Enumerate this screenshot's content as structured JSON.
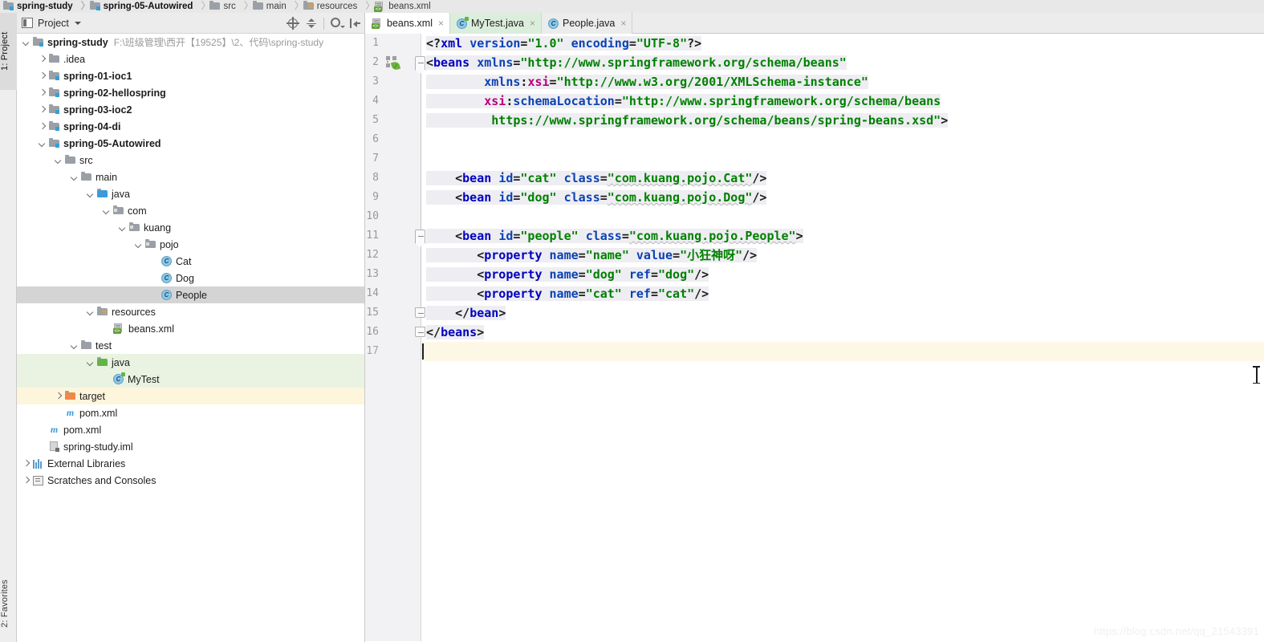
{
  "breadcrumb": {
    "items": [
      {
        "label": "spring-study",
        "icon": "module-icon",
        "bold": true
      },
      {
        "label": "spring-05-Autowired",
        "icon": "module-icon",
        "bold": true
      },
      {
        "label": "src",
        "icon": "folder-icon",
        "bold": false
      },
      {
        "label": "main",
        "icon": "folder-icon",
        "bold": false
      },
      {
        "label": "resources",
        "icon": "resources-folder-icon",
        "bold": false
      },
      {
        "label": "beans.xml",
        "icon": "xml-file-icon",
        "bold": false
      }
    ]
  },
  "left_strip": {
    "project_tab": "1: Project",
    "favorites_tab": "2: Favorites"
  },
  "project_panel": {
    "title": "Project",
    "toolbar": {
      "locate": "locate-in-tree-icon",
      "collapse_all": "collapse-all-icon",
      "settings": "gear-icon",
      "hide": "hide-panel-icon"
    },
    "tree": [
      {
        "id": "spring-study",
        "depth": 0,
        "arrow": "down",
        "icon": "module-icon",
        "label": "spring-study",
        "bold": true,
        "path": "F:\\班级管理\\西开【19525】\\2、代码\\spring-study",
        "state": "none"
      },
      {
        "id": "idea",
        "depth": 1,
        "arrow": "right",
        "icon": "folder-icon",
        "label": ".idea",
        "bold": false,
        "path": "",
        "state": "none"
      },
      {
        "id": "spring-01-ioc1",
        "depth": 1,
        "arrow": "right",
        "icon": "module-icon",
        "label": "spring-01-ioc1",
        "bold": true,
        "path": "",
        "state": "none"
      },
      {
        "id": "spring-02-hellospring",
        "depth": 1,
        "arrow": "right",
        "icon": "module-icon",
        "label": "spring-02-hellospring",
        "bold": true,
        "path": "",
        "state": "none"
      },
      {
        "id": "spring-03-ioc2",
        "depth": 1,
        "arrow": "right",
        "icon": "module-icon",
        "label": "spring-03-ioc2",
        "bold": true,
        "path": "",
        "state": "none"
      },
      {
        "id": "spring-04-di",
        "depth": 1,
        "arrow": "right",
        "icon": "module-icon",
        "label": "spring-04-di",
        "bold": true,
        "path": "",
        "state": "none"
      },
      {
        "id": "spring-05-Autowired",
        "depth": 1,
        "arrow": "down",
        "icon": "module-icon",
        "label": "spring-05-Autowired",
        "bold": true,
        "path": "",
        "state": "none"
      },
      {
        "id": "src",
        "depth": 2,
        "arrow": "down",
        "icon": "folder-icon",
        "label": "src",
        "bold": false,
        "path": "",
        "state": "none"
      },
      {
        "id": "main",
        "depth": 3,
        "arrow": "down",
        "icon": "folder-icon",
        "label": "main",
        "bold": false,
        "path": "",
        "state": "none"
      },
      {
        "id": "java",
        "depth": 4,
        "arrow": "down",
        "icon": "source-folder-icon",
        "label": "java",
        "bold": false,
        "path": "",
        "state": "none"
      },
      {
        "id": "com",
        "depth": 5,
        "arrow": "down",
        "icon": "package-icon",
        "label": "com",
        "bold": false,
        "path": "",
        "state": "none"
      },
      {
        "id": "kuang",
        "depth": 6,
        "arrow": "down",
        "icon": "package-icon",
        "label": "kuang",
        "bold": false,
        "path": "",
        "state": "none"
      },
      {
        "id": "pojo",
        "depth": 7,
        "arrow": "down",
        "icon": "package-icon",
        "label": "pojo",
        "bold": false,
        "path": "",
        "state": "none"
      },
      {
        "id": "Cat",
        "depth": 8,
        "arrow": "none",
        "icon": "java-class-icon",
        "label": "Cat",
        "bold": false,
        "path": "",
        "state": "none"
      },
      {
        "id": "Dog",
        "depth": 8,
        "arrow": "none",
        "icon": "java-class-icon",
        "label": "Dog",
        "bold": false,
        "path": "",
        "state": "none"
      },
      {
        "id": "People",
        "depth": 8,
        "arrow": "none",
        "icon": "java-class-icon",
        "label": "People",
        "bold": false,
        "path": "",
        "state": "selected"
      },
      {
        "id": "resources",
        "depth": 4,
        "arrow": "down",
        "icon": "resources-folder-icon",
        "label": "resources",
        "bold": false,
        "path": "",
        "state": "none"
      },
      {
        "id": "beans.xml",
        "depth": 5,
        "arrow": "none",
        "icon": "xml-file-icon",
        "label": "beans.xml",
        "bold": false,
        "path": "",
        "state": "none"
      },
      {
        "id": "test",
        "depth": 3,
        "arrow": "down",
        "icon": "folder-icon",
        "label": "test",
        "bold": false,
        "path": "",
        "state": "none"
      },
      {
        "id": "test-java",
        "depth": 4,
        "arrow": "down",
        "icon": "test-source-folder-icon",
        "label": "java",
        "bold": false,
        "path": "",
        "state": "green"
      },
      {
        "id": "MyTest",
        "depth": 5,
        "arrow": "none",
        "icon": "java-test-class-icon",
        "label": "MyTest",
        "bold": false,
        "path": "",
        "state": "green"
      },
      {
        "id": "target",
        "depth": 2,
        "arrow": "right",
        "icon": "excluded-folder-icon",
        "label": "target",
        "bold": false,
        "path": "",
        "state": "yellow"
      },
      {
        "id": "module-pom",
        "depth": 2,
        "arrow": "none",
        "icon": "maven-icon",
        "label": "pom.xml",
        "bold": false,
        "path": "",
        "state": "none"
      },
      {
        "id": "root-pom",
        "depth": 1,
        "arrow": "none",
        "icon": "maven-icon",
        "label": "pom.xml",
        "bold": false,
        "path": "",
        "state": "none"
      },
      {
        "id": "spring-study.iml",
        "depth": 1,
        "arrow": "none",
        "icon": "iml-file-icon",
        "label": "spring-study.iml",
        "bold": false,
        "path": "",
        "state": "none"
      },
      {
        "id": "External Libraries",
        "depth": 0,
        "arrow": "right",
        "icon": "libraries-icon",
        "label": "External Libraries",
        "bold": false,
        "path": "",
        "state": "none"
      },
      {
        "id": "Scratches and Consoles",
        "depth": 0,
        "arrow": "right",
        "icon": "scratches-icon",
        "label": "Scratches and Consoles",
        "bold": false,
        "path": "",
        "state": "none"
      }
    ]
  },
  "editor": {
    "tabs": [
      {
        "label": "beans.xml",
        "icon": "xml-file-icon",
        "state": "active",
        "close": "×"
      },
      {
        "label": "MyTest.java",
        "icon": "java-test-class-icon",
        "state": "modified",
        "close": "×"
      },
      {
        "label": "People.java",
        "icon": "java-class-icon",
        "state": "inactive",
        "close": "×"
      }
    ],
    "line_numbers": [
      "1",
      "2",
      "3",
      "4",
      "5",
      "6",
      "7",
      "8",
      "9",
      "10",
      "11",
      "12",
      "13",
      "14",
      "15",
      "16",
      "17"
    ],
    "current_line": 17,
    "gutter_icons": [
      {
        "line": 2,
        "icon": "spring-bean-icon"
      }
    ],
    "code_lines": [
      {
        "n": 1,
        "indent": 0,
        "tokens": [
          {
            "t": "<?",
            "c": "punct"
          },
          {
            "t": "xml",
            "c": "tag"
          },
          {
            "t": " ",
            "c": "plain"
          },
          {
            "t": "version",
            "c": "attr"
          },
          {
            "t": "=",
            "c": "eq"
          },
          {
            "t": "\"1.0\"",
            "c": "val"
          },
          {
            "t": " ",
            "c": "plain"
          },
          {
            "t": "encoding",
            "c": "attr"
          },
          {
            "t": "=",
            "c": "eq"
          },
          {
            "t": "\"UTF-8\"",
            "c": "val"
          },
          {
            "t": "?>",
            "c": "punct"
          }
        ]
      },
      {
        "n": 2,
        "indent": 0,
        "tokens": [
          {
            "t": "<",
            "c": "punct"
          },
          {
            "t": "beans",
            "c": "tag"
          },
          {
            "t": " ",
            "c": "plain"
          },
          {
            "t": "xmlns",
            "c": "attr"
          },
          {
            "t": "=",
            "c": "eq"
          },
          {
            "t": "\"http://www.springframework.org/schema/beans\"",
            "c": "val"
          }
        ]
      },
      {
        "n": 3,
        "indent": 8,
        "tokens": [
          {
            "t": "xmlns",
            "c": "attr"
          },
          {
            "t": ":",
            "c": "punct"
          },
          {
            "t": "xsi",
            "c": "ns"
          },
          {
            "t": "=",
            "c": "eq"
          },
          {
            "t": "\"http://www.w3.org/2001/XMLSchema-instance\"",
            "c": "val"
          }
        ]
      },
      {
        "n": 4,
        "indent": 8,
        "tokens": [
          {
            "t": "xsi",
            "c": "ns"
          },
          {
            "t": ":",
            "c": "punct"
          },
          {
            "t": "schemaLocation",
            "c": "attr"
          },
          {
            "t": "=",
            "c": "eq"
          },
          {
            "t": "\"http://www.springframework.org/schema/beans",
            "c": "val"
          }
        ]
      },
      {
        "n": 5,
        "indent": 9,
        "tokens": [
          {
            "t": "https://www.springframework.org/schema/beans/spring-beans.xsd\"",
            "c": "val"
          },
          {
            "t": ">",
            "c": "punct"
          }
        ]
      },
      {
        "n": 6,
        "indent": 0,
        "tokens": []
      },
      {
        "n": 7,
        "indent": 0,
        "tokens": []
      },
      {
        "n": 8,
        "indent": 4,
        "tokens": [
          {
            "t": "<",
            "c": "punct"
          },
          {
            "t": "bean",
            "c": "tag"
          },
          {
            "t": " ",
            "c": "plain"
          },
          {
            "t": "id",
            "c": "attr"
          },
          {
            "t": "=",
            "c": "eq"
          },
          {
            "t": "\"cat\"",
            "c": "val"
          },
          {
            "t": " ",
            "c": "plain"
          },
          {
            "t": "class",
            "c": "attr"
          },
          {
            "t": "=",
            "c": "eq"
          },
          {
            "t": "\"com.kuang.pojo.Cat\"",
            "c": "val-squiggle"
          },
          {
            "t": "/>",
            "c": "punct"
          }
        ]
      },
      {
        "n": 9,
        "indent": 4,
        "tokens": [
          {
            "t": "<",
            "c": "punct"
          },
          {
            "t": "bean",
            "c": "tag"
          },
          {
            "t": " ",
            "c": "plain"
          },
          {
            "t": "id",
            "c": "attr"
          },
          {
            "t": "=",
            "c": "eq"
          },
          {
            "t": "\"dog\"",
            "c": "val"
          },
          {
            "t": " ",
            "c": "plain"
          },
          {
            "t": "class",
            "c": "attr"
          },
          {
            "t": "=",
            "c": "eq"
          },
          {
            "t": "\"com.kuang.pojo.Dog\"",
            "c": "val-squiggle"
          },
          {
            "t": "/>",
            "c": "punct"
          }
        ]
      },
      {
        "n": 10,
        "indent": 0,
        "tokens": []
      },
      {
        "n": 11,
        "indent": 4,
        "tokens": [
          {
            "t": "<",
            "c": "punct"
          },
          {
            "t": "bean",
            "c": "tag"
          },
          {
            "t": " ",
            "c": "plain"
          },
          {
            "t": "id",
            "c": "attr"
          },
          {
            "t": "=",
            "c": "eq"
          },
          {
            "t": "\"people\"",
            "c": "val"
          },
          {
            "t": " ",
            "c": "plain"
          },
          {
            "t": "class",
            "c": "attr"
          },
          {
            "t": "=",
            "c": "eq"
          },
          {
            "t": "\"com.kuang.pojo.People\"",
            "c": "val-squiggle"
          },
          {
            "t": ">",
            "c": "punct"
          }
        ]
      },
      {
        "n": 12,
        "indent": 7,
        "tokens": [
          {
            "t": "<",
            "c": "punct"
          },
          {
            "t": "property",
            "c": "tag"
          },
          {
            "t": " ",
            "c": "plain"
          },
          {
            "t": "name",
            "c": "attr"
          },
          {
            "t": "=",
            "c": "eq"
          },
          {
            "t": "\"name\"",
            "c": "val"
          },
          {
            "t": " ",
            "c": "plain"
          },
          {
            "t": "value",
            "c": "attr"
          },
          {
            "t": "=",
            "c": "eq"
          },
          {
            "t": "\"小狂神呀\"",
            "c": "val"
          },
          {
            "t": "/>",
            "c": "punct"
          }
        ]
      },
      {
        "n": 13,
        "indent": 7,
        "tokens": [
          {
            "t": "<",
            "c": "punct"
          },
          {
            "t": "property",
            "c": "tag"
          },
          {
            "t": " ",
            "c": "plain"
          },
          {
            "t": "name",
            "c": "attr"
          },
          {
            "t": "=",
            "c": "eq"
          },
          {
            "t": "\"dog\"",
            "c": "val"
          },
          {
            "t": " ",
            "c": "plain"
          },
          {
            "t": "ref",
            "c": "attr"
          },
          {
            "t": "=",
            "c": "eq"
          },
          {
            "t": "\"dog\"",
            "c": "val"
          },
          {
            "t": "/>",
            "c": "punct"
          }
        ]
      },
      {
        "n": 14,
        "indent": 7,
        "tokens": [
          {
            "t": "<",
            "c": "punct"
          },
          {
            "t": "property",
            "c": "tag"
          },
          {
            "t": " ",
            "c": "plain"
          },
          {
            "t": "name",
            "c": "attr"
          },
          {
            "t": "=",
            "c": "eq"
          },
          {
            "t": "\"cat\"",
            "c": "val"
          },
          {
            "t": " ",
            "c": "plain"
          },
          {
            "t": "ref",
            "c": "attr"
          },
          {
            "t": "=",
            "c": "eq"
          },
          {
            "t": "\"cat\"",
            "c": "val"
          },
          {
            "t": "/>",
            "c": "punct"
          }
        ]
      },
      {
        "n": 15,
        "indent": 4,
        "tokens": [
          {
            "t": "</",
            "c": "punct"
          },
          {
            "t": "bean",
            "c": "tag"
          },
          {
            "t": ">",
            "c": "punct"
          }
        ]
      },
      {
        "n": 16,
        "indent": 0,
        "tokens": [
          {
            "t": "</",
            "c": "punct"
          },
          {
            "t": "beans",
            "c": "tag"
          },
          {
            "t": ">",
            "c": "punct"
          }
        ]
      },
      {
        "n": 17,
        "indent": 0,
        "tokens": []
      }
    ]
  },
  "watermark": "https://blog.csdn.net/qq_21543391",
  "colors": {
    "tag": "#0000c0",
    "attribute": "#0c42b4",
    "namespace": "#b8007b",
    "value": "#008000",
    "selection": "#d4d4d4",
    "test_source": "#eaf3e2",
    "excluded": "#fdf6dd",
    "current_line": "#fdf8e6"
  }
}
